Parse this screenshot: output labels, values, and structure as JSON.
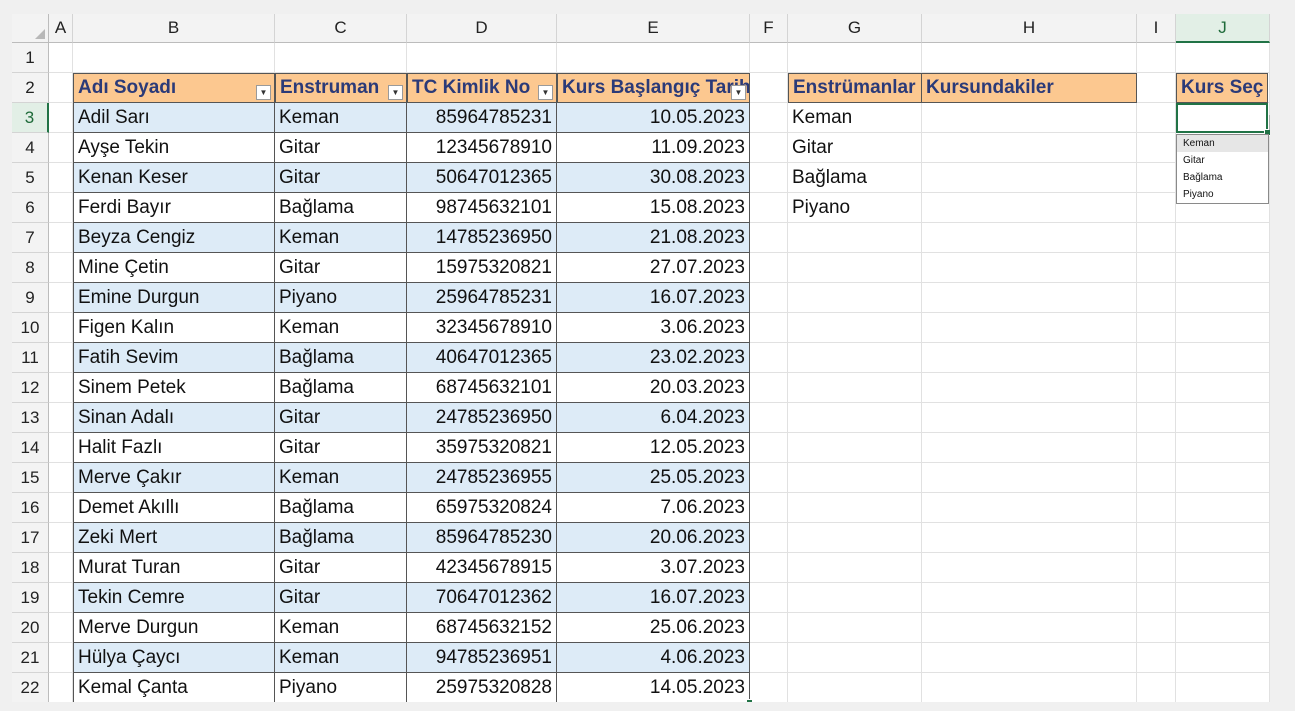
{
  "columns": [
    "A",
    "B",
    "C",
    "D",
    "E",
    "F",
    "G",
    "H",
    "I",
    "J"
  ],
  "rows": [
    "1",
    "2",
    "3",
    "4",
    "5",
    "6",
    "7",
    "8",
    "9",
    "10",
    "11",
    "12",
    "13",
    "14",
    "15",
    "16",
    "17",
    "18",
    "19",
    "20",
    "21",
    "22"
  ],
  "table": {
    "headers": [
      "Adı Soyadı",
      "Enstruman",
      "TC Kimlik No",
      "Kurs Başlangıç Tarihi"
    ],
    "records": [
      [
        "Adil Sarı",
        "Keman",
        "85964785231",
        "10.05.2023"
      ],
      [
        "Ayşe Tekin",
        "Gitar",
        "12345678910",
        "11.09.2023"
      ],
      [
        "Kenan Keser",
        "Gitar",
        "50647012365",
        "30.08.2023"
      ],
      [
        "Ferdi Bayır",
        "Bağlama",
        "98745632101",
        "15.08.2023"
      ],
      [
        "Beyza Cengiz",
        "Keman",
        "14785236950",
        "21.08.2023"
      ],
      [
        "Mine Çetin",
        "Gitar",
        "15975320821",
        "27.07.2023"
      ],
      [
        "Emine Durgun",
        "Piyano",
        "25964785231",
        "16.07.2023"
      ],
      [
        "Figen Kalın",
        "Keman",
        "32345678910",
        "3.06.2023"
      ],
      [
        "Fatih Sevim",
        "Bağlama",
        "40647012365",
        "23.02.2023"
      ],
      [
        "Sinem Petek",
        "Bağlama",
        "68745632101",
        "20.03.2023"
      ],
      [
        "Sinan Adalı",
        "Gitar",
        "24785236950",
        "6.04.2023"
      ],
      [
        "Halit Fazlı",
        "Gitar",
        "35975320821",
        "12.05.2023"
      ],
      [
        "Merve Çakır",
        "Keman",
        "24785236955",
        "25.05.2023"
      ],
      [
        "Demet Akıllı",
        "Bağlama",
        "65975320824",
        "7.06.2023"
      ],
      [
        "Zeki Mert",
        "Bağlama",
        "85964785230",
        "20.06.2023"
      ],
      [
        "Murat Turan",
        "Gitar",
        "42345678915",
        "3.07.2023"
      ],
      [
        "Tekin Cemre",
        "Gitar",
        "70647012362",
        "16.07.2023"
      ],
      [
        "Merve Durgun",
        "Keman",
        "68745632152",
        "25.06.2023"
      ],
      [
        "Hülya Çaycı",
        "Keman",
        "94785236951",
        "4.06.2023"
      ],
      [
        "Kemal Çanta",
        "Piyano",
        "25975320828",
        "14.05.2023"
      ]
    ]
  },
  "summary": {
    "header_instruments": "Enstrümanlar",
    "header_participants": "Kursundakiler",
    "instruments": [
      "Keman",
      "Gitar",
      "Bağlama",
      "Piyano"
    ]
  },
  "selector": {
    "header": "Kurs Seç",
    "value": "",
    "options": [
      "Keman",
      "Gitar",
      "Bağlama",
      "Piyano"
    ],
    "highlighted_option": "Keman"
  },
  "selection": {
    "active_cell": "J3"
  },
  "colors": {
    "header_fill": "#fcc890",
    "header_text": "#2b3a78",
    "band_fill": "#ddebf7",
    "selection_accent": "#217346"
  }
}
